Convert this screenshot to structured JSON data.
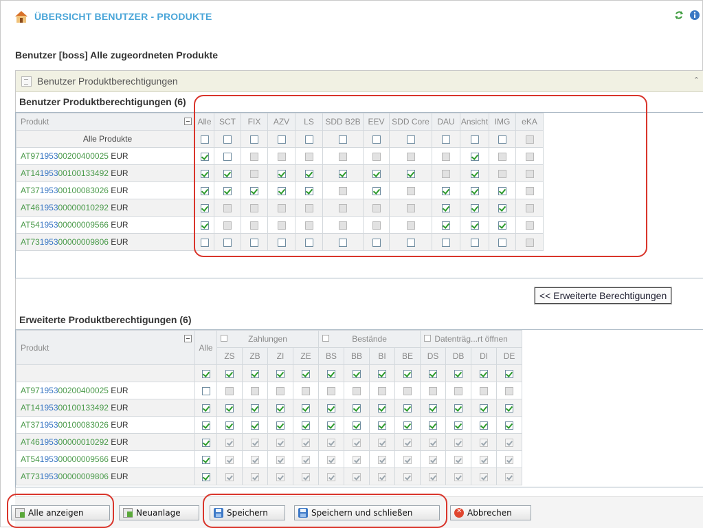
{
  "header": {
    "title": "ÜBERSICHT BENUTZER - PRODUKTE"
  },
  "subtitle": "Benutzer [boss]  Alle zugeordneten Produkte",
  "panel": {
    "title": "Benutzer Produktberechtigungen",
    "collapse_glyph": "⌃"
  },
  "grid1": {
    "title": "Benutzer Produktberechtigungen (6)",
    "product_header": "Produkt",
    "columns": [
      "Alle",
      "SCT",
      "FIX",
      "AZV",
      "LS",
      "SDD B2B",
      "EEV",
      "SDD Core",
      "DAU",
      "Ansicht",
      "IMG",
      "eKA"
    ],
    "all_row_label": "Alle Produkte",
    "rows": [
      {
        "iban_a": "AT97",
        "iban_b": "1953",
        "iban_c": "00200400025",
        "currency": "EUR",
        "states": [
          "on",
          "off",
          "dis",
          "dis",
          "dis",
          "dis",
          "dis",
          "dis",
          "dis",
          "on",
          "dis",
          "dis"
        ]
      },
      {
        "iban_a": "AT14",
        "iban_b": "1953",
        "iban_c": "00100133492",
        "currency": "EUR",
        "states": [
          "on",
          "on",
          "dis",
          "on",
          "on",
          "on",
          "on",
          "on",
          "dis",
          "on",
          "dis",
          "dis"
        ]
      },
      {
        "iban_a": "AT37",
        "iban_b": "1953",
        "iban_c": "00100083026",
        "currency": "EUR",
        "states": [
          "on",
          "on",
          "on",
          "on",
          "on",
          "dis",
          "on",
          "dis",
          "on",
          "on",
          "on",
          "dis"
        ]
      },
      {
        "iban_a": "AT46",
        "iban_b": "1953",
        "iban_c": "00000010292",
        "currency": "EUR",
        "states": [
          "on",
          "dis",
          "dis",
          "dis",
          "dis",
          "dis",
          "dis",
          "dis",
          "on",
          "on",
          "on",
          "dis"
        ]
      },
      {
        "iban_a": "AT54",
        "iban_b": "1953",
        "iban_c": "00000009566",
        "currency": "EUR",
        "states": [
          "on",
          "dis",
          "dis",
          "dis",
          "dis",
          "dis",
          "dis",
          "dis",
          "on",
          "on",
          "on",
          "dis"
        ]
      },
      {
        "iban_a": "AT73",
        "iban_b": "1953",
        "iban_c": "00000009806",
        "currency": "EUR",
        "states": [
          "off",
          "off",
          "off",
          "off",
          "off",
          "off",
          "off",
          "off",
          "off",
          "off",
          "off",
          "dis"
        ]
      }
    ]
  },
  "extended_button": "<< Erweiterte Berechtigungen",
  "grid2": {
    "title": "Erweiterte Produktberechtigungen (6)",
    "product_header": "Produkt",
    "all_header": "Alle",
    "groups": [
      {
        "label": "Zahlungen",
        "cols": [
          "ZS",
          "ZB",
          "ZI",
          "ZE"
        ]
      },
      {
        "label": "Bestände",
        "cols": [
          "BS",
          "BB",
          "BI",
          "BE"
        ]
      },
      {
        "label": "Datenträg...rt öffnen",
        "cols": [
          "DS",
          "DB",
          "DI",
          "DE"
        ]
      }
    ],
    "top_row": [
      "",
      "on",
      "on",
      "on",
      "on",
      "on",
      "on",
      "on",
      "on",
      "on",
      "on",
      "on",
      "on",
      "on"
    ],
    "rows": [
      {
        "iban_a": "AT97",
        "iban_b": "1953",
        "iban_c": "00200400025",
        "currency": "EUR",
        "states": [
          "off",
          "dis",
          "dis",
          "dis",
          "dis",
          "dis",
          "dis",
          "dis",
          "dis",
          "dis",
          "dis",
          "dis",
          "dis"
        ]
      },
      {
        "iban_a": "AT14",
        "iban_b": "1953",
        "iban_c": "00100133492",
        "currency": "EUR",
        "states": [
          "on",
          "on",
          "on",
          "on",
          "on",
          "on",
          "on",
          "on",
          "on",
          "on",
          "on",
          "on",
          "on"
        ]
      },
      {
        "iban_a": "AT37",
        "iban_b": "1953",
        "iban_c": "00100083026",
        "currency": "EUR",
        "states": [
          "on",
          "on",
          "on",
          "on",
          "on",
          "on",
          "on",
          "on",
          "on",
          "on",
          "on",
          "on",
          "on"
        ]
      },
      {
        "iban_a": "AT46",
        "iban_b": "1953",
        "iban_c": "00000010292",
        "currency": "EUR",
        "states": [
          "on",
          "dison",
          "dison",
          "dison",
          "dison",
          "dison",
          "dison",
          "dison",
          "dison",
          "dison",
          "dison",
          "dison",
          "dison"
        ]
      },
      {
        "iban_a": "AT54",
        "iban_b": "1953",
        "iban_c": "00000009566",
        "currency": "EUR",
        "states": [
          "on",
          "dison",
          "dison",
          "dison",
          "dison",
          "dison",
          "dison",
          "dison",
          "dison",
          "dison",
          "dison",
          "dison",
          "dison"
        ]
      },
      {
        "iban_a": "AT73",
        "iban_b": "1953",
        "iban_c": "00000009806",
        "currency": "EUR",
        "states": [
          "on",
          "dison",
          "dison",
          "dison",
          "dison",
          "dison",
          "dison",
          "dison",
          "dison",
          "dison",
          "dison",
          "dison",
          "dison"
        ]
      }
    ]
  },
  "footer": {
    "show_all": "Alle anzeigen",
    "new": "Neuanlage",
    "save": "Speichern",
    "save_close": "Speichern und schließen",
    "cancel": "Abbrechen"
  },
  "colors": {
    "title": "#49a5d8",
    "highlight": "#d9352b",
    "iban_green": "#4a9a4a",
    "iban_blue": "#3b78c4"
  }
}
